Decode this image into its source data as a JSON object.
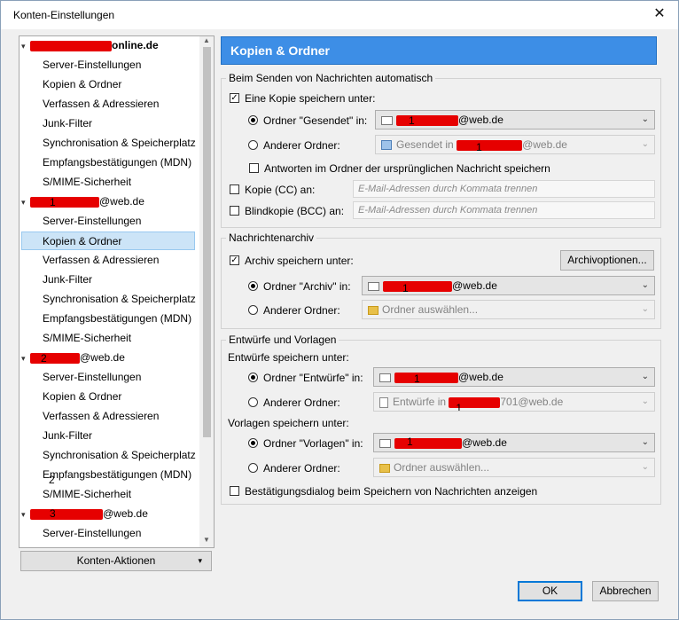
{
  "window": {
    "title": "Konten-Einstellungen",
    "close_glyph": "✕"
  },
  "tree": {
    "accounts": [
      {
        "name_suffix": "online.de",
        "marker": ""
      },
      {
        "name_suffix": "@web.de",
        "marker": "1"
      },
      {
        "name_suffix": "@web.de",
        "marker": "2"
      },
      {
        "name_suffix": "@web.de",
        "marker": "3"
      }
    ],
    "items": {
      "server": "Server-Einstellungen",
      "copies": "Kopien & Ordner",
      "compose": "Verfassen & Adressieren",
      "junk": "Junk-Filter",
      "sync": "Synchronisation & Speicherplatz",
      "mdn": "Empfangsbestätigungen (MDN)",
      "smime": "S/MIME-Sicherheit"
    },
    "extra_marker": "2"
  },
  "account_actions": "Konten-Aktionen",
  "panel": {
    "title": "Kopien & Ordner",
    "sending": {
      "legend": "Beim Senden von Nachrichten automatisch",
      "save_copy": "Eine Kopie speichern unter:",
      "folder_sent": "Ordner \"Gesendet\" in:",
      "sent_value_suffix": "@web.de",
      "sent_marker": "1",
      "other_folder": "Anderer Ordner:",
      "other_value_prefix": "Gesendet in",
      "other_value_suffix": "@web.de",
      "other_marker": "1",
      "reply_in_folder": "Antworten im Ordner der ursprünglichen Nachricht speichern",
      "cc_label": "Kopie (CC) an:",
      "bcc_label": "Blindkopie (BCC) an:",
      "address_placeholder": "E-Mail-Adressen durch Kommata trennen"
    },
    "archive": {
      "legend": "Nachrichtenarchiv",
      "save_archive": "Archiv speichern unter:",
      "options_button": "Archivoptionen...",
      "folder_archive": "Ordner \"Archiv\" in:",
      "archive_value_suffix": "@web.de",
      "archive_marker": "1",
      "other_folder": "Anderer Ordner:",
      "choose_folder": "Ordner auswählen..."
    },
    "drafts": {
      "legend": "Entwürfe und Vorlagen",
      "drafts_save": "Entwürfe speichern unter:",
      "folder_drafts": "Ordner \"Entwürfe\" in:",
      "drafts_value_suffix": "@web.de",
      "drafts_marker": "1",
      "other_folder": "Anderer Ordner:",
      "other_drafts_prefix": "Entwürfe in",
      "other_drafts_suffix": "701@web.de",
      "other_drafts_marker": "1",
      "templates_save": "Vorlagen speichern unter:",
      "folder_templates": "Ordner \"Vorlagen\" in:",
      "templates_value_suffix": "@web.de",
      "templates_marker": "1",
      "other_folder2": "Anderer Ordner:",
      "choose_folder": "Ordner auswählen...",
      "confirm_dialog": "Bestätigungsdialog beim Speichern von Nachrichten anzeigen"
    }
  },
  "buttons": {
    "ok": "OK",
    "cancel": "Abbrechen"
  },
  "icons": {
    "check": "✓",
    "dropdown": "⌄",
    "up": "▲",
    "down": "▼",
    "small_down": "▾"
  }
}
